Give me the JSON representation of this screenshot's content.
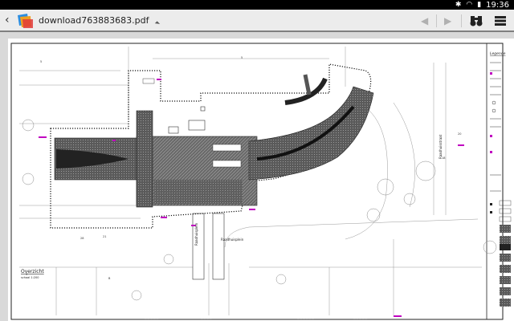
{
  "status_bar": {
    "time": "19:36",
    "icons": [
      "bluetooth-icon",
      "wifi-icon",
      "battery-icon"
    ]
  },
  "action_bar": {
    "back_icon": "chevron-left-icon",
    "app_icon": "pdf-viewer-logo",
    "file_name": "download763883683.pdf",
    "nav_prev_icon": "previous-page-icon",
    "nav_next_icon": "next-page-icon",
    "find_icon": "binoculars-icon",
    "menu_icon": "overflow-menu-icon"
  },
  "document": {
    "legend_title": "Legende",
    "overview_label": "Overzicht",
    "overview_scale": "schaal 1:200",
    "street_name_vertical": "Raadhuisplein",
    "street_name_horizontal": "Raadhuisplein",
    "street_name_right": "Raadhuisstraat"
  },
  "colors": {
    "status_bar": "#000000",
    "action_bar": "#ececec",
    "paper": "#ffffff",
    "viewer_bg": "#d9d9d9",
    "annotation_magenta": "#c000c0",
    "paving_dark": "#4a4a4a"
  }
}
